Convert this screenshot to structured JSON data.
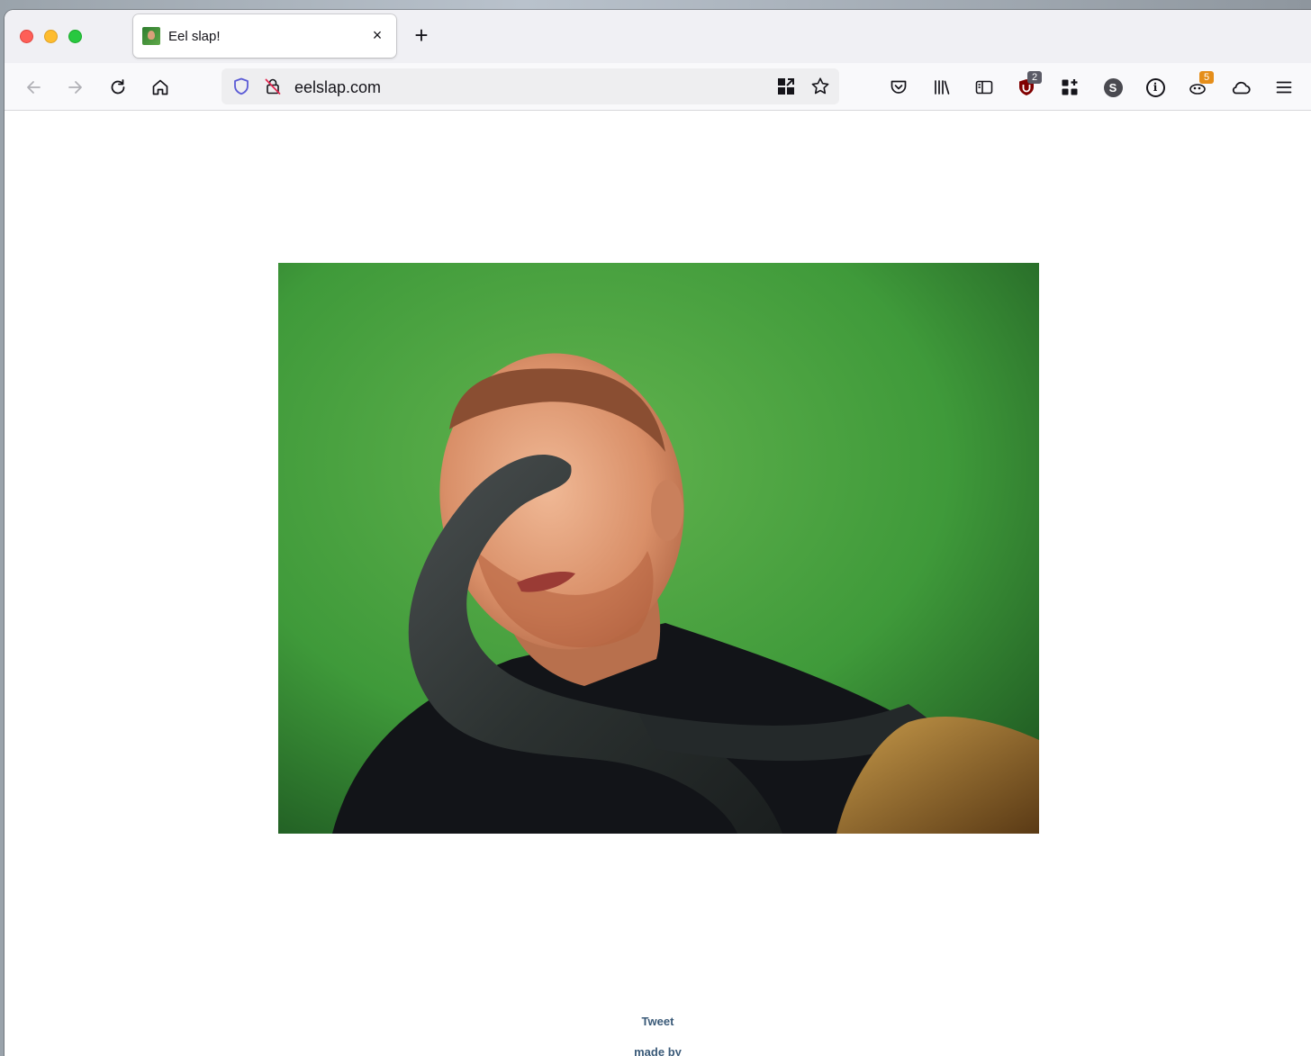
{
  "browser": {
    "tab": {
      "title": "Eel slap!"
    },
    "new_tab_label": "+",
    "tab_close_label": "×",
    "url": "eelslap.com",
    "badges": {
      "ublock": "2",
      "extension": "5"
    },
    "extension_letters": {
      "s_icon": "S",
      "info_icon": "i"
    }
  },
  "page": {
    "image_alt": "Man being slapped with an eel",
    "tweet_label": "Tweet",
    "made_by_label": "made by"
  },
  "colors": {
    "accent_shield": "#5b5bd6",
    "ublock_red": "#800000",
    "badge_gray": "#5b5b66",
    "badge_orange": "#e58e1a",
    "green_screen": "#3f9a3a"
  }
}
